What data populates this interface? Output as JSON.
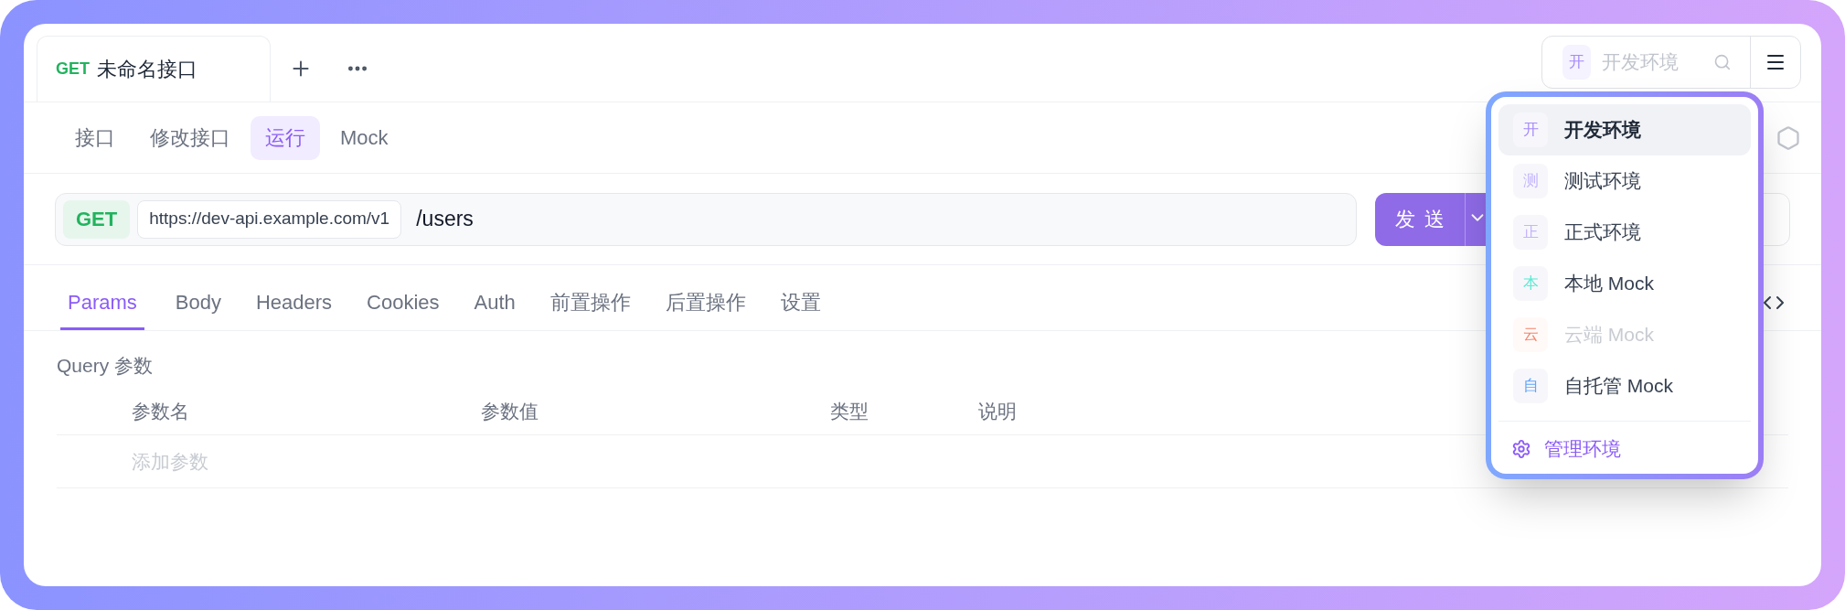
{
  "request_tab": {
    "method": "GET",
    "title": "未命名接口"
  },
  "environment_selector": {
    "badge": "开",
    "placeholder": "开发环境"
  },
  "sub_tabs": [
    {
      "label": "接口",
      "selected": false
    },
    {
      "label": "修改接口",
      "selected": false
    },
    {
      "label": "运行",
      "selected": true
    },
    {
      "label": "Mock",
      "selected": false
    }
  ],
  "request": {
    "method": "GET",
    "base_url": "https://dev-api.example.com/v1",
    "path": "/users",
    "send_label": "发送"
  },
  "param_tabs": [
    {
      "label": "Params",
      "selected": true
    },
    {
      "label": "Body",
      "selected": false
    },
    {
      "label": "Headers",
      "selected": false
    },
    {
      "label": "Cookies",
      "selected": false
    },
    {
      "label": "Auth",
      "selected": false
    },
    {
      "label": "前置操作",
      "selected": false
    },
    {
      "label": "后置操作",
      "selected": false
    },
    {
      "label": "设置",
      "selected": false
    }
  ],
  "query": {
    "title": "Query 参数",
    "columns": [
      "参数名",
      "参数值",
      "类型",
      "说明"
    ],
    "placeholder": "添加参数"
  },
  "environments": [
    {
      "badge": "开",
      "name": "开发环境",
      "color": "#a78bfa",
      "selected": true,
      "disabled": false
    },
    {
      "badge": "测",
      "name": "测试环境",
      "color": "#c4b5fd",
      "selected": false,
      "disabled": false
    },
    {
      "badge": "正",
      "name": "正式环境",
      "color": "#c4b5fd",
      "selected": false,
      "disabled": false
    },
    {
      "badge": "本",
      "name": "本地 Mock",
      "color": "#5eead4",
      "selected": false,
      "disabled": false
    },
    {
      "badge": "云",
      "name": "云端 Mock",
      "color": "#f4866c",
      "selected": false,
      "disabled": true
    },
    {
      "badge": "自",
      "name": "自托管 Mock",
      "color": "#60a5fa",
      "selected": false,
      "disabled": false
    }
  ],
  "manage_label": "管理环境"
}
